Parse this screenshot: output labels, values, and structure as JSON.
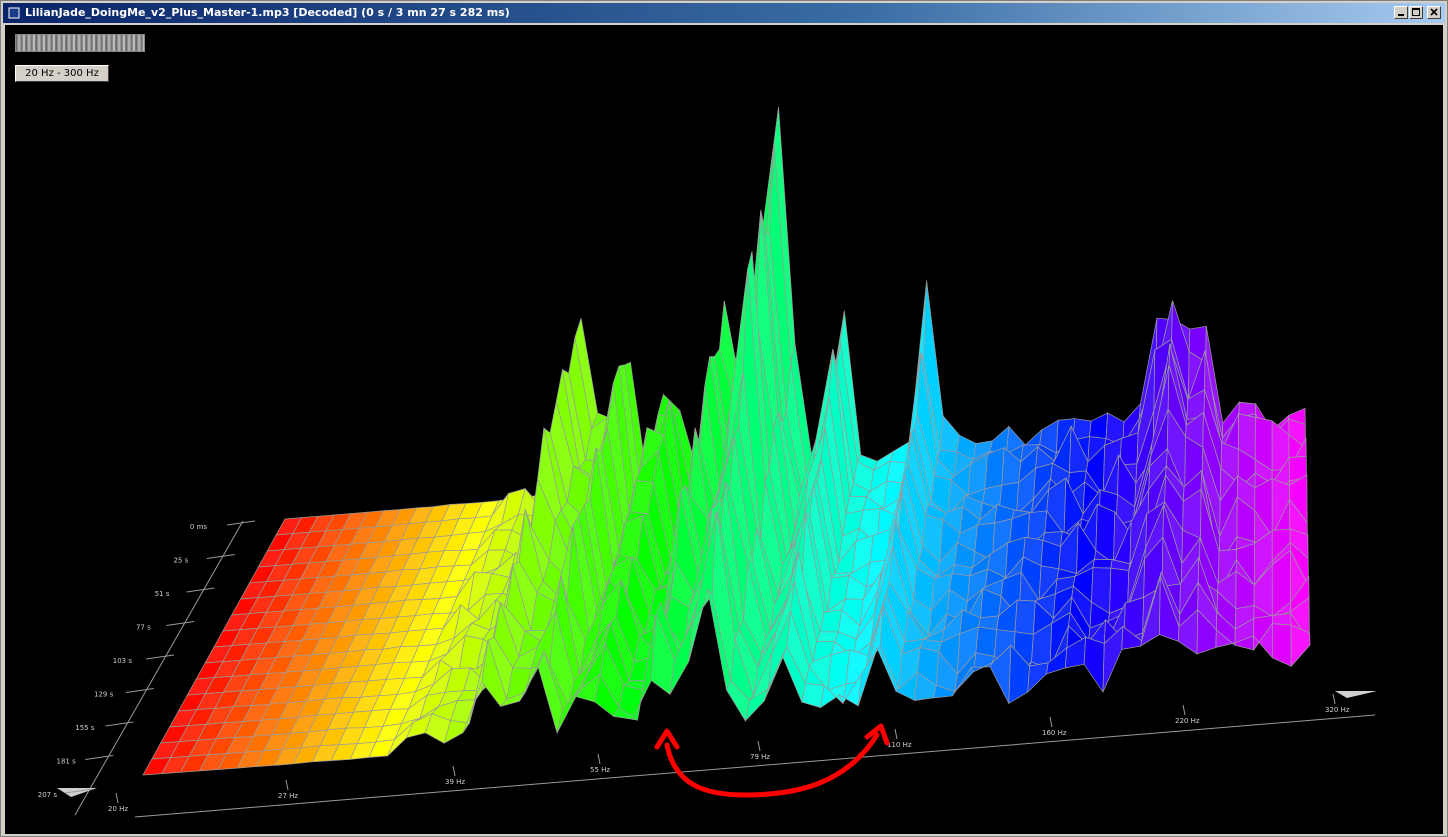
{
  "window": {
    "title": "LilianJade_DoingMe_v2_Plus_Master-1.mp3 [Decoded] (0 s / 3 mn 27 s 282 ms)"
  },
  "icons": {
    "minimize": "minimize-icon",
    "maximize": "maximize-icon",
    "close": "close-icon",
    "app": "app-icon"
  },
  "controls": {
    "range_button": "20 Hz - 300 Hz"
  },
  "axes": {
    "time_ticks": [
      "0 ms",
      "25 s",
      "51 s",
      "77 s",
      "103 s",
      "129 s",
      "155 s",
      "181 s",
      "207 s"
    ],
    "freq_ticks": [
      "20 Hz",
      "27 Hz",
      "39 Hz",
      "55 Hz",
      "79 Hz",
      "110 Hz",
      "160 Hz",
      "220 Hz",
      "320 Hz"
    ]
  },
  "colors": {
    "wireframe": "#9a9a9a",
    "annotation": "#ff0000",
    "titlebar_start": "#0a246a"
  }
}
